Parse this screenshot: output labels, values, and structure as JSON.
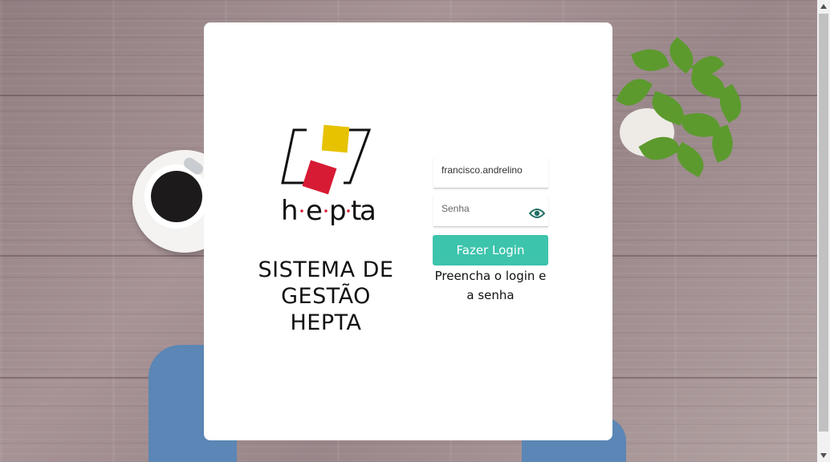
{
  "brand": {
    "logo_text": "h·e·p·t·a",
    "system_title_lines": [
      "SISTEMA DE",
      "GESTÃO",
      "HEPTA"
    ],
    "colors": {
      "accent": "#3dc4ac",
      "logo_yellow": "#e7c200",
      "logo_red": "#d71b34"
    }
  },
  "login_form": {
    "username": {
      "value": "francisco.andrelino",
      "placeholder": ""
    },
    "password": {
      "value": "",
      "placeholder": "Senha",
      "toggle_icon": "eye-icon"
    },
    "submit_label": "Fazer Login",
    "hint_text": "Preencha o login e a senha"
  },
  "scrollbar": {
    "up_icon": "arrow-up-icon",
    "down_icon": "arrow-down-icon"
  }
}
